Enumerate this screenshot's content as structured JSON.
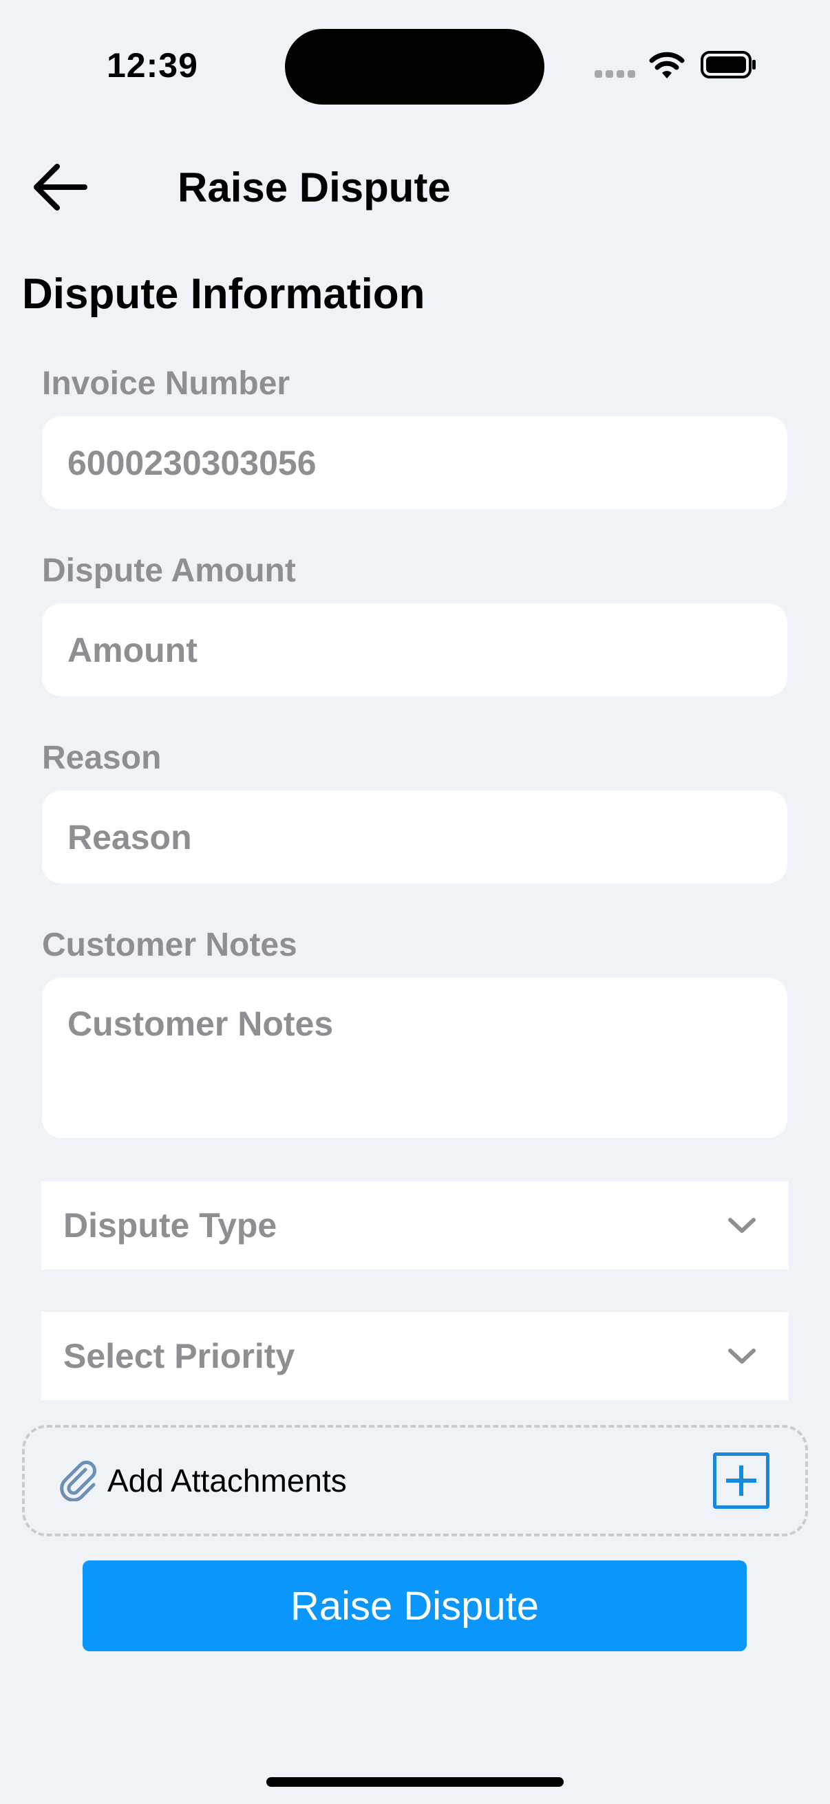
{
  "status_bar": {
    "time": "12:39"
  },
  "header": {
    "title": "Raise Dispute"
  },
  "section": {
    "title": "Dispute Information"
  },
  "fields": {
    "invoice_number": {
      "label": "Invoice Number",
      "value": "6000230303056"
    },
    "dispute_amount": {
      "label": "Dispute Amount",
      "placeholder": "Amount"
    },
    "reason": {
      "label": "Reason",
      "placeholder": "Reason"
    },
    "customer_notes": {
      "label": "Customer Notes",
      "placeholder": "Customer Notes"
    }
  },
  "selects": {
    "dispute_type": {
      "placeholder": "Dispute Type"
    },
    "priority": {
      "placeholder": "Select Priority"
    }
  },
  "attachments": {
    "label": "Add Attachments",
    "icon": "paperclip-icon"
  },
  "submit": {
    "label": "Raise Dispute"
  },
  "colors": {
    "background": "#eff2f7",
    "primary": "#0a96fb",
    "add_icon": "#1689dd",
    "muted_text": "#8e8e93"
  }
}
